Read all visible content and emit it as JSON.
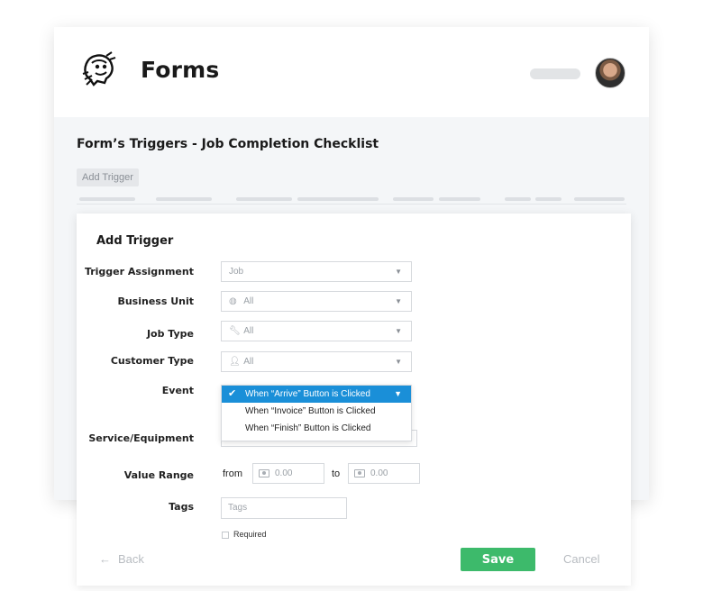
{
  "header": {
    "app_title": "Forms",
    "logo_icon": "cartoon-mascot-logo-icon",
    "avatar_icon": "user-avatar-photo"
  },
  "page": {
    "title": "Form’s Triggers - Job Completion Checklist",
    "add_trigger_chip": "Add Trigger"
  },
  "modal": {
    "title": "Add Trigger",
    "fields": {
      "trigger_assignment": {
        "label": "Trigger Assignment",
        "value": "Job"
      },
      "business_unit": {
        "label": "Business Unit",
        "value": "All",
        "icon": "globe-icon"
      },
      "job_type": {
        "label": "Job Type",
        "value": "All",
        "icon": "wrench-icon"
      },
      "customer_type": {
        "label": "Customer Type",
        "value": "All",
        "icon": "person-icon"
      },
      "event": {
        "label": "Event",
        "options": [
          "When “Arrive” Button is Clicked",
          "When “Invoice” Button is Clicked",
          "When “Finish” Button is Clicked"
        ],
        "selected_index": 0
      },
      "service_equipment": {
        "label": "Service/Equipment"
      },
      "value_range": {
        "label": "Value Range",
        "from_word": "from",
        "to_word": "to",
        "from_placeholder": "0.00",
        "to_placeholder": "0.00"
      },
      "tags": {
        "label": "Tags",
        "placeholder": "Tags"
      },
      "required": {
        "label": "Required"
      }
    },
    "buttons": {
      "back": "Back",
      "save": "Save",
      "cancel": "Cancel"
    }
  },
  "colors": {
    "accent_green": "#3dba6b",
    "selected_blue": "#1a8fd8"
  }
}
